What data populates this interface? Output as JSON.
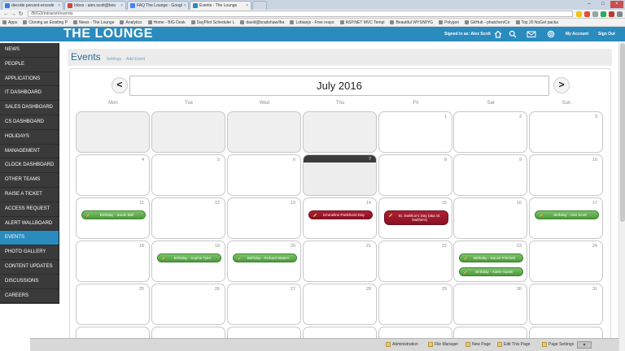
{
  "browser": {
    "tabs": [
      {
        "label": "decode percent-encode"
      },
      {
        "label": "Inbox - alex.scott@bou"
      },
      {
        "label": "FAQ The Lounge - Googl"
      },
      {
        "label": "Events - The Lounge",
        "active": true
      },
      {
        "label": ""
      }
    ],
    "url": "/BIG3/intranet/events",
    "bookmarks": [
      "Apps",
      "Cloning an Existing P",
      "News - The Lounge",
      "Analytics",
      "Home - BIG Desk",
      "DayPilot Scheduler L",
      "david@bradshaw/ifra",
      "Lobianjs - Free respo",
      "ASP.NET MVC Templ",
      "Beautiful WYSIWYG",
      "Polygon",
      "GitHub - phatchen/Ce",
      "Top 20 NuGet packa"
    ]
  },
  "header": {
    "logo": "THE LOUNGE",
    "signed_in": "Signed in as: Alex Scott",
    "my_account": "My Account",
    "sign_out": "Sign Out"
  },
  "sidebar": {
    "items": [
      {
        "label": "NEWS"
      },
      {
        "label": "PEOPLE"
      },
      {
        "label": "APPLICATIONS"
      },
      {
        "label": "IT DASHBOARD"
      },
      {
        "label": "SALES DASHBOARD"
      },
      {
        "label": "CS DASHBOARD"
      },
      {
        "label": "HOLIDAYS"
      },
      {
        "label": "MANAGEMENT"
      },
      {
        "label": "CLOCK DASHBOARD"
      },
      {
        "label": "OTHER TEAMS"
      },
      {
        "label": "RAISE A TICKET"
      },
      {
        "label": "ACCESS REQUEST"
      },
      {
        "label": "ALERT WALLBOARD"
      },
      {
        "label": "EVENTS",
        "active": true
      },
      {
        "label": "PHOTO GALLERY"
      },
      {
        "label": "CONTENT UPDATES"
      },
      {
        "label": "DISCUSSIONS"
      },
      {
        "label": "CAREERS"
      }
    ]
  },
  "page": {
    "title": "Events",
    "settings_link": "Settings",
    "add_event_link": "Add Event"
  },
  "calendar": {
    "month_label": "July 2016",
    "prev_label": "<",
    "next_label": ">",
    "weekdays": [
      "Mon",
      "Tue",
      "Wed",
      "Thu",
      "Fri",
      "Sat",
      "Sun"
    ],
    "today": "7",
    "weeks": [
      [
        "",
        "",
        "",
        "",
        "1",
        "2",
        "3"
      ],
      [
        "4",
        "5",
        "6",
        "7",
        "8",
        "9",
        "10"
      ],
      [
        "11",
        "12",
        "13",
        "14",
        "15",
        "16",
        "17"
      ],
      [
        "18",
        "19",
        "20",
        "21",
        "22",
        "23",
        "24"
      ],
      [
        "25",
        "26",
        "27",
        "28",
        "29",
        "30",
        "31"
      ]
    ],
    "events": [
      {
        "week": 2,
        "day": 0,
        "slot": 0,
        "label": "Birthday - Sarah Bell",
        "color": "green"
      },
      {
        "week": 2,
        "day": 3,
        "slot": 0,
        "label": "Emmeline Pankhurst Day",
        "color": "red"
      },
      {
        "week": 2,
        "day": 4,
        "slot": 0,
        "label": "St. Swithun's Day (aka St. Swithin's)",
        "color": "red"
      },
      {
        "week": 2,
        "day": 6,
        "slot": 0,
        "label": "Birthday - Alex Scott",
        "color": "green"
      },
      {
        "week": 3,
        "day": 1,
        "slot": 0,
        "label": "Birthday - Sophie Tyler",
        "color": "green"
      },
      {
        "week": 3,
        "day": 2,
        "slot": 0,
        "label": "Birthday - Richard Waters",
        "color": "green"
      },
      {
        "week": 3,
        "day": 5,
        "slot": 0,
        "label": "Birthday - Daniel Pritchett",
        "color": "green"
      },
      {
        "week": 3,
        "day": 5,
        "slot": 1,
        "label": "Birthday - Adele Hunter",
        "color": "green"
      }
    ]
  },
  "adminbar": {
    "items": [
      "Administration",
      "File Manager",
      "New Page",
      "Edit This Page",
      "Page Settings"
    ]
  },
  "colors": {
    "brand": "#2a8bbf",
    "sidebar": "#3a3a3a",
    "event_green": "#5aa647",
    "event_red": "#9a1529"
  }
}
